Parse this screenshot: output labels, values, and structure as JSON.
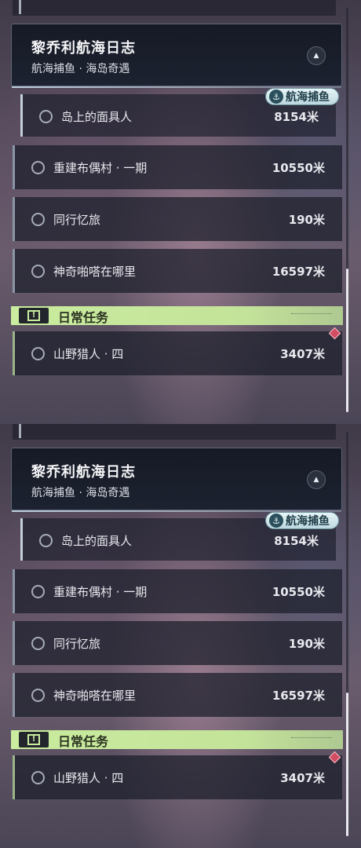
{
  "panels": [
    {
      "header": {
        "title": "黎乔利航海日志",
        "subtitle": "航海捕鱼 · 海岛奇遇"
      },
      "badge": {
        "label": "航海捕鱼",
        "icon": "anchor-icon"
      },
      "quests": [
        {
          "name": "岛上的面具人",
          "distance": "8154米"
        },
        {
          "name": "重建布偶村 · 一期",
          "distance": "10550米"
        },
        {
          "name": "同行忆旅",
          "distance": "190米"
        },
        {
          "name": "神奇啪嗒在哪里",
          "distance": "16597米"
        }
      ],
      "daily_section": {
        "title": "日常任务",
        "icon_glyph": "!"
      },
      "daily_quests": [
        {
          "name": "山野猎人 · 四",
          "distance": "3407米"
        }
      ]
    },
    {
      "header": {
        "title": "黎乔利航海日志",
        "subtitle": "航海捕鱼 · 海岛奇遇"
      },
      "badge": {
        "label": "航海捕鱼",
        "icon": "anchor-icon"
      },
      "quests": [
        {
          "name": "岛上的面具人",
          "distance": "8154米"
        },
        {
          "name": "重建布偶村 · 一期",
          "distance": "10550米"
        },
        {
          "name": "同行忆旅",
          "distance": "190米"
        },
        {
          "name": "神奇啪嗒在哪里",
          "distance": "16597米"
        }
      ],
      "daily_section": {
        "title": "日常任务",
        "icon_glyph": "!"
      },
      "daily_quests": [
        {
          "name": "山野猎人 · 四",
          "distance": "3407米"
        }
      ]
    }
  ],
  "colors": {
    "section_accent": "#c9ec9e",
    "alert_diamond": "#d24d62",
    "panel_dark": "#1a1d2a"
  }
}
